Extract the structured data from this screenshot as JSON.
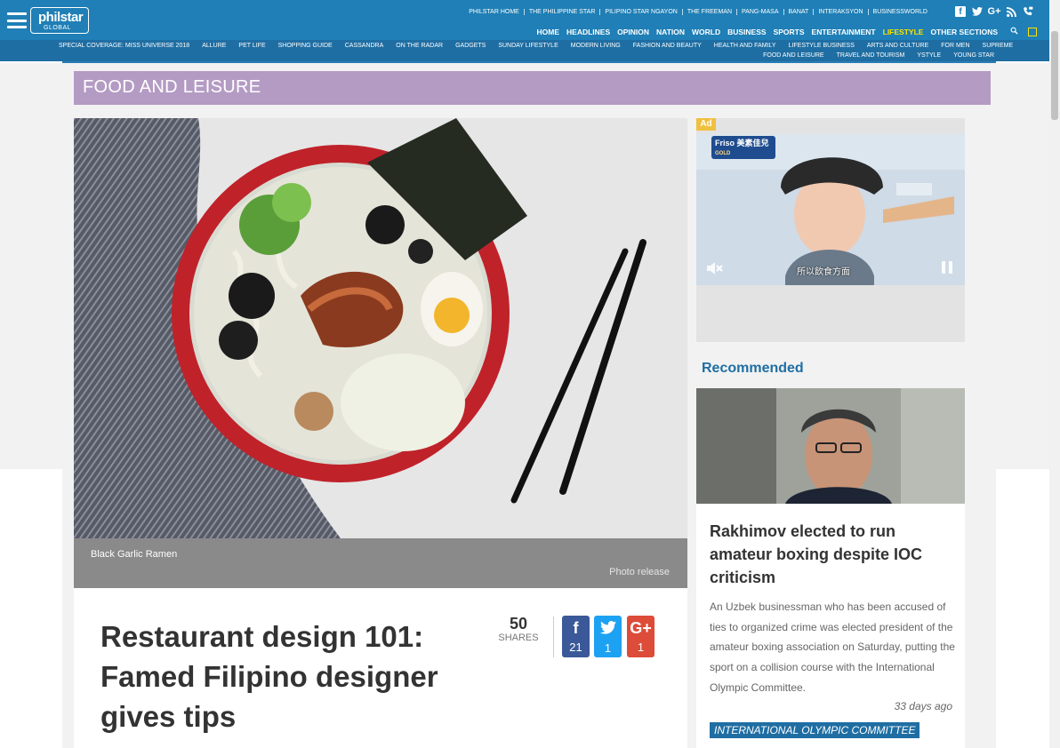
{
  "header": {
    "logo_main": "philstar",
    "logo_sub": "GLOBAL",
    "top_links": [
      "PHILSTAR HOME",
      "THE PHILIPPINE STAR",
      "PILIPINO STAR NGAYON",
      "THE FREEMAN",
      "PANG-MASA",
      "BANAT",
      "INTERAKSYON",
      "BUSINESSWORLD"
    ],
    "social": [
      "f",
      "t",
      "G+",
      "rss",
      "phone"
    ],
    "main_nav": [
      "HOME",
      "HEADLINES",
      "OPINION",
      "NATION",
      "WORLD",
      "BUSINESS",
      "SPORTS",
      "ENTERTAINMENT",
      "LIFESTYLE",
      "OTHER SECTIONS"
    ],
    "active_nav": "LIFESTYLE"
  },
  "subnav": {
    "row1": [
      "SPECIAL COVERAGE: MISS UNIVERSE 2018",
      "ALLURE",
      "PET LIFE",
      "SHOPPING GUIDE",
      "CASSANDRA",
      "ON THE RADAR",
      "GADGETS",
      "SUNDAY LIFESTYLE",
      "MODERN LIVING",
      "FASHION AND BEAUTY",
      "HEALTH AND FAMILY",
      "LIFESTYLE BUSINESS",
      "ARTS AND CULTURE",
      "FOR MEN",
      "SUPREME"
    ],
    "row2": [
      "FOOD AND LEISURE",
      "TRAVEL AND TOURISM",
      "YSTYLE",
      "YOUNG STAR"
    ]
  },
  "section": {
    "title": "FOOD AND LEISURE"
  },
  "hero": {
    "caption": "Black Garlic Ramen",
    "credit": "Photo release"
  },
  "article": {
    "headline": "Restaurant design 101: Famed Filipino designer gives tips",
    "shares_count": "50",
    "shares_label": "SHARES",
    "facebook_glyph": "f",
    "facebook_count": "21",
    "twitter_count": "1",
    "googleplus_glyph": "G+",
    "googleplus_count": "1"
  },
  "ad": {
    "label": "Ad",
    "brand": "Friso 美素佳兒",
    "brand_sub": "GOLD",
    "subtitle": "所以飲食方面"
  },
  "recommended": {
    "title": "Recommended",
    "headline": "Rakhimov elected to run amateur boxing despite IOC criticism",
    "summary": "An Uzbek businessman who has been accused of ties to organized crime was elected president of the amateur boxing association on Saturday, putting the sport on a collision course with the International Olympic Committee.",
    "time": "33 days ago",
    "tag": "INTERNATIONAL OLYMPIC COMMITTEE"
  },
  "colors": {
    "header_blue": "#1f7fb6",
    "subnav_blue": "#1f6ea3",
    "section_purple": "#b49bc3",
    "active_yellow": "#ffe300",
    "facebook": "#3b5998",
    "twitter": "#1da1f2",
    "googleplus": "#dd4b39"
  }
}
